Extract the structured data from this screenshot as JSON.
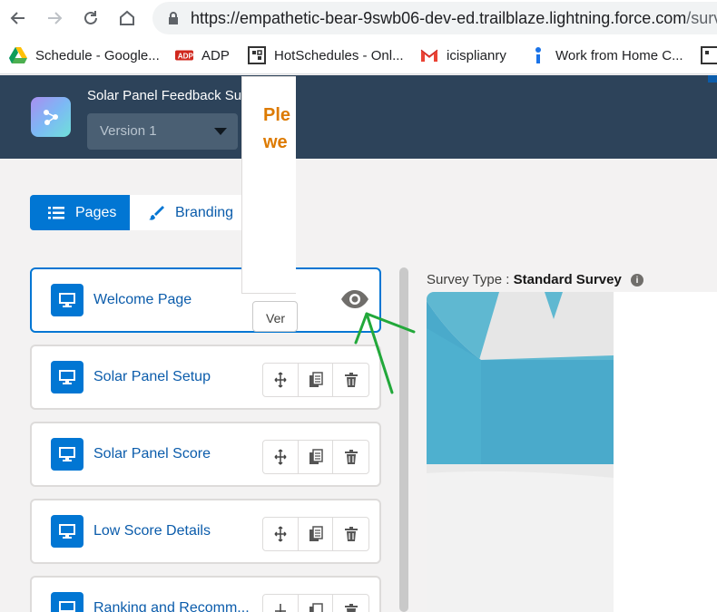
{
  "browser": {
    "url_host": "https://empathetic-bear-9swb06-dev-ed.trailblaze.lightning.force.com",
    "url_path": "/surve",
    "bookmarks": [
      {
        "label": "Schedule - Google..."
      },
      {
        "label": "ADP"
      },
      {
        "label": "HotSchedules - Onl..."
      },
      {
        "label": "icisplianry"
      },
      {
        "label": "Work from Home C..."
      }
    ]
  },
  "header": {
    "survey_title": "Solar Panel Feedback Survey",
    "version_value": "Version 1"
  },
  "tabs": [
    {
      "label": "Pages",
      "active": true
    },
    {
      "label": "Branding",
      "active": false
    }
  ],
  "pages": [
    {
      "label": "Welcome Page"
    },
    {
      "label": "Solar Panel Setup"
    },
    {
      "label": "Solar Panel Score"
    },
    {
      "label": "Low Score Details"
    },
    {
      "label": "Ranking and Recomm..."
    }
  ],
  "preview": {
    "survey_type_label": "Survey Type :",
    "survey_type_value": "Standard Survey",
    "question_text_line1": "Ple",
    "question_text_line2": "we",
    "response_button": "Ver"
  },
  "colors": {
    "header_bg": "#2d435a",
    "brand_blue": "#0176d3",
    "link_blue": "#0b5cab",
    "orange": "#dd7a01",
    "annotation_green": "#22a83a"
  }
}
